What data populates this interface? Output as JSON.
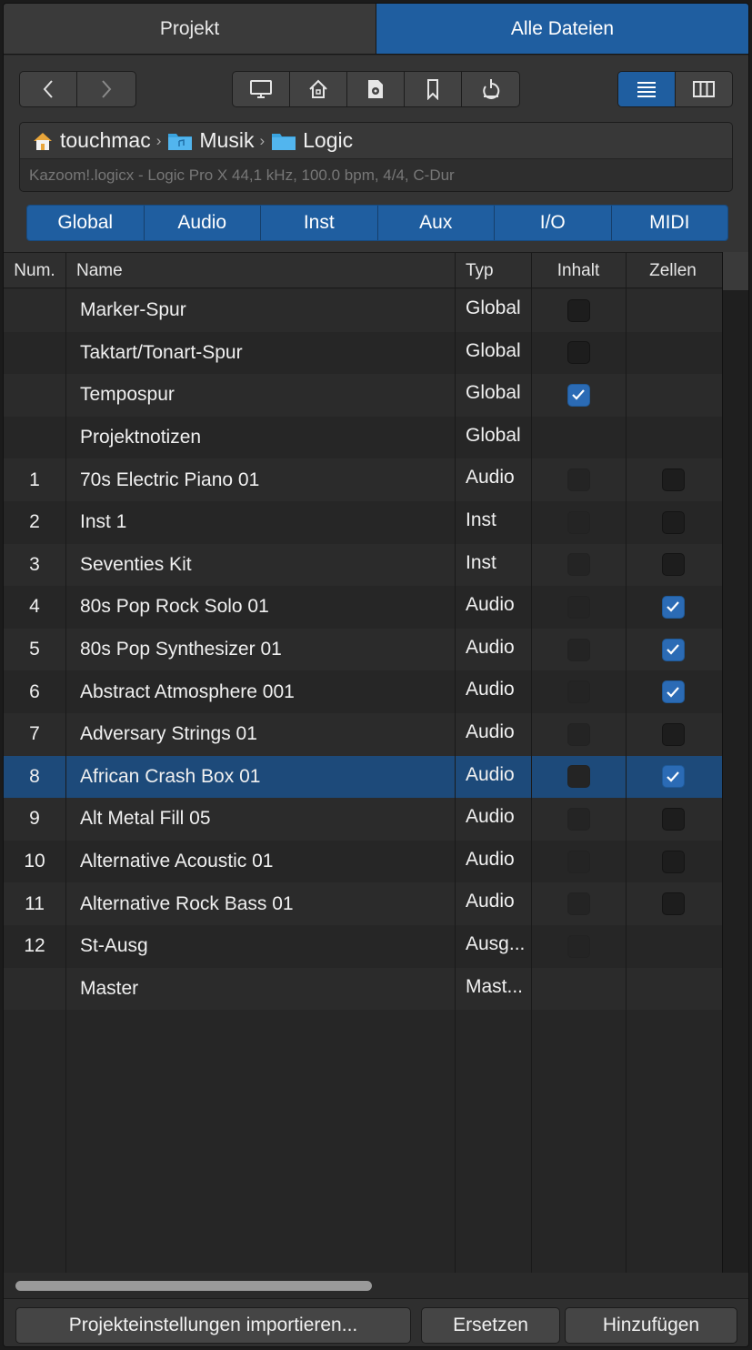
{
  "tabs": [
    {
      "label": "Projekt",
      "active": false
    },
    {
      "label": "Alle Dateien",
      "active": true
    }
  ],
  "toolbar": {
    "nav": [
      "back-icon",
      "forward-icon"
    ],
    "locations": [
      "computer-icon",
      "home-icon",
      "project-icon",
      "bookmark-icon",
      "recent-icon"
    ],
    "views": [
      "list-view-icon",
      "column-view-icon"
    ]
  },
  "path": {
    "segments": [
      {
        "label": "touchmac",
        "icon": "home-folder-icon"
      },
      {
        "label": "Musik",
        "icon": "music-folder-icon"
      },
      {
        "label": "Logic",
        "icon": "folder-icon"
      }
    ],
    "info": "Kazoom!.logicx - Logic Pro X 44,1 kHz, 100.0 bpm, 4/4, C-Dur"
  },
  "filters": [
    "Global",
    "Audio",
    "Inst",
    "Aux",
    "I/O",
    "MIDI"
  ],
  "columns": {
    "num": "Num.",
    "name": "Name",
    "typ": "Typ",
    "inhalt": "Inhalt",
    "zellen": "Zellen"
  },
  "rows": [
    {
      "num": "",
      "name": "Marker-Spur",
      "typ": "Global",
      "inhalt": "off",
      "zellen": "none"
    },
    {
      "num": "",
      "name": "Taktart/Tonart-Spur",
      "typ": "Global",
      "inhalt": "off",
      "zellen": "none"
    },
    {
      "num": "",
      "name": "Tempospur",
      "typ": "Global",
      "inhalt": "on",
      "zellen": "none"
    },
    {
      "num": "",
      "name": "Projektnotizen",
      "typ": "Global",
      "inhalt": "none",
      "zellen": "none"
    },
    {
      "num": "1",
      "name": "70s Electric Piano 01",
      "typ": "Audio",
      "inhalt": "dim",
      "zellen": "off"
    },
    {
      "num": "2",
      "name": "Inst 1",
      "typ": "Inst",
      "inhalt": "dim",
      "zellen": "off"
    },
    {
      "num": "3",
      "name": "Seventies Kit",
      "typ": "Inst",
      "inhalt": "dim",
      "zellen": "off"
    },
    {
      "num": "4",
      "name": "80s Pop Rock Solo 01",
      "typ": "Audio",
      "inhalt": "dim",
      "zellen": "on"
    },
    {
      "num": "5",
      "name": "80s Pop Synthesizer 01",
      "typ": "Audio",
      "inhalt": "dim",
      "zellen": "on"
    },
    {
      "num": "6",
      "name": "Abstract Atmosphere 001",
      "typ": "Audio",
      "inhalt": "dim",
      "zellen": "on"
    },
    {
      "num": "7",
      "name": "Adversary Strings 01",
      "typ": "Audio",
      "inhalt": "dim",
      "zellen": "off"
    },
    {
      "num": "8",
      "name": "African Crash Box 01",
      "typ": "Audio",
      "inhalt": "dim",
      "zellen": "on",
      "selected": true
    },
    {
      "num": "9",
      "name": "Alt Metal Fill 05",
      "typ": "Audio",
      "inhalt": "dim",
      "zellen": "off"
    },
    {
      "num": "10",
      "name": "Alternative Acoustic 01",
      "typ": "Audio",
      "inhalt": "dim",
      "zellen": "off"
    },
    {
      "num": "11",
      "name": "Alternative Rock Bass 01",
      "typ": "Audio",
      "inhalt": "dim",
      "zellen": "off"
    },
    {
      "num": "12",
      "name": "St-Ausg",
      "typ": "Ausg...",
      "inhalt": "dim",
      "zellen": "none"
    },
    {
      "num": "",
      "name": "Master",
      "typ": "Mast...",
      "inhalt": "none",
      "zellen": "none"
    }
  ],
  "footer": {
    "import_label": "Projekteinstellungen importieren...",
    "replace_label": "Ersetzen",
    "add_label": "Hinzufügen"
  },
  "colors": {
    "accent": "#1f5ea0",
    "selection": "#1d4a7a",
    "checkbox_on": "#2b6bb5"
  }
}
